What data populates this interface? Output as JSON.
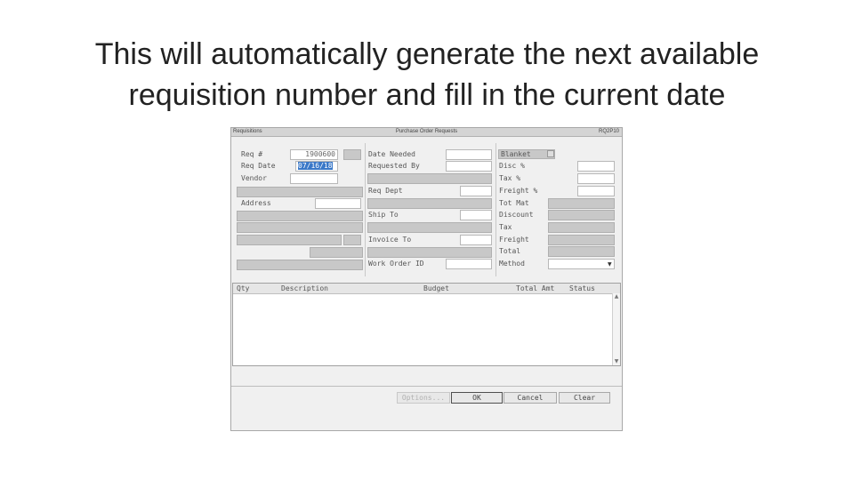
{
  "slide": {
    "title_line1": "This will automatically generate the next available",
    "title_line2": "requisition number and fill in the current date"
  },
  "window": {
    "title_left": "Requisitions",
    "title_center": "Purchase Order Requests",
    "title_right": "RQ2P10"
  },
  "left": {
    "req_label": "Req #",
    "req_value": "1900600",
    "req_date_label": "Req Date",
    "req_date_value": "07/16/18",
    "vendor_label": "Vendor",
    "address_label": "Address"
  },
  "middle": {
    "date_needed_label": "Date Needed",
    "requested_by_label": "Requested By",
    "req_dept_label": "Req Dept",
    "ship_to_label": "Ship To",
    "invoice_to_label": "Invoice To",
    "work_order_label": "Work Order ID"
  },
  "right": {
    "blanket_label": "Blanket",
    "disc_label": "Disc %",
    "tax_pct_label": "Tax %",
    "freight_pct_label": "Freight %",
    "tot_mat_label": "Tot Mat",
    "discount_label": "Discount",
    "tax_label": "Tax",
    "freight_label": "Freight",
    "total_label": "Total",
    "method_label": "Method"
  },
  "grid": {
    "columns": [
      "Qty",
      "Description",
      "Budget",
      "Total Amt",
      "Status"
    ]
  },
  "buttons": {
    "options": "Options...",
    "ok": "OK",
    "cancel": "Cancel",
    "clear": "Clear"
  },
  "icons": {
    "scroll_up": "scroll-up-icon",
    "scroll_down": "scroll-down-icon",
    "dropdown": "chevron-down-icon"
  }
}
